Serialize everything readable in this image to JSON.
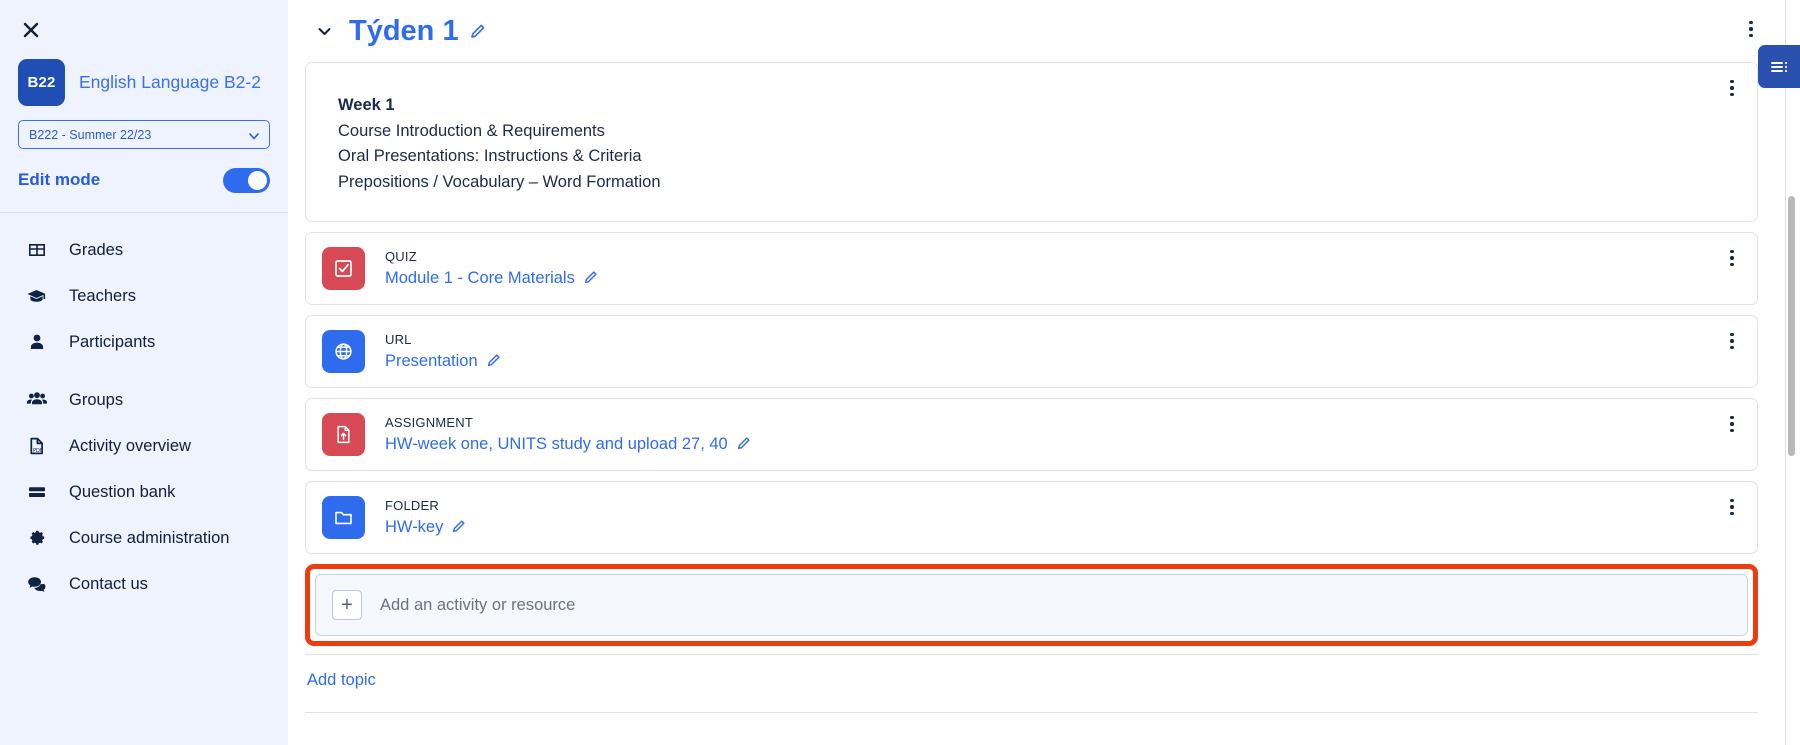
{
  "sidebar": {
    "close_label": "×",
    "course": {
      "badge": "B22",
      "title": "English Language B2-2"
    },
    "term_select": {
      "value": "B222 - Summer 22/23"
    },
    "edit_mode": {
      "label": "Edit mode",
      "enabled": true
    },
    "items": [
      {
        "label": "Grades",
        "icon": "grades-table-icon"
      },
      {
        "label": "Teachers",
        "icon": "graduation-cap-icon"
      },
      {
        "label": "Participants",
        "icon": "person-icon"
      },
      {
        "label": "Groups",
        "icon": "people-group-icon"
      },
      {
        "label": "Activity overview",
        "icon": "pdf-document-icon"
      },
      {
        "label": "Question bank",
        "icon": "question-bank-icon"
      },
      {
        "label": "Course administration",
        "icon": "gear-icon"
      },
      {
        "label": "Contact us",
        "icon": "chat-bubbles-icon"
      }
    ]
  },
  "main": {
    "section_title": "Týden 1",
    "summary": {
      "lines": [
        "Week 1",
        "Course Introduction & Requirements",
        "Oral Presentations: Instructions & Criteria",
        "Prepositions / Vocabulary – Word Formation"
      ]
    },
    "activities": [
      {
        "type": "QUIZ",
        "name": "Module 1 - Core Materials",
        "icon": "quiz-checkbox-icon",
        "color": "#d74a55"
      },
      {
        "type": "URL",
        "name": "Presentation",
        "icon": "globe-icon",
        "color": "#2f6ced"
      },
      {
        "type": "ASSIGNMENT",
        "name": "HW-week one, UNITS study and upload 27, 40",
        "icon": "assignment-upload-icon",
        "color": "#d74a55"
      },
      {
        "type": "FOLDER",
        "name": "HW-key",
        "icon": "folder-icon",
        "color": "#2f6ced"
      }
    ],
    "add_activity_label": "Add an activity or resource",
    "add_topic_label": "Add topic",
    "plus_symbol": "+"
  },
  "colors": {
    "accent": "#2f6ced",
    "highlight_border": "#ef3b11",
    "sidebar_bg": "#eef3fd",
    "badge_bg": "#1f4eb5",
    "drawer_btn_bg": "#2950ad"
  },
  "drawer_button": {
    "icon": "block-drawer-icon"
  }
}
